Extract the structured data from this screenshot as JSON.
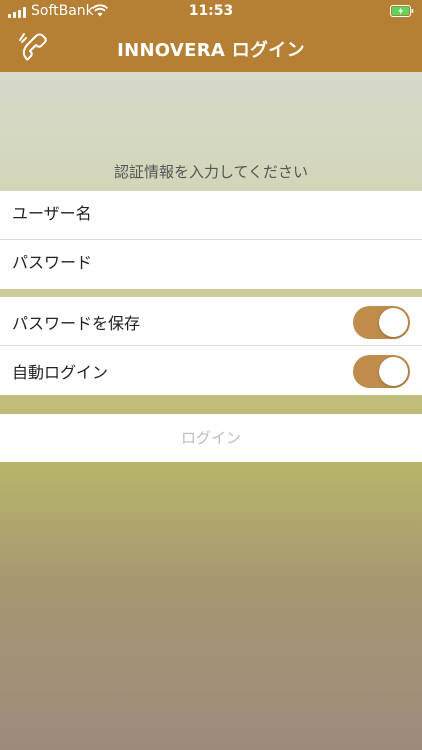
{
  "status_bar": {
    "carrier": "SoftBank",
    "time": "11:53"
  },
  "nav": {
    "title": "INNOVERA ログイン",
    "left_icon": "phone-icon"
  },
  "form": {
    "section_header": "認証情報を入力してください",
    "username_placeholder": "ユーザー名",
    "password_placeholder": "パスワード"
  },
  "options": {
    "save_password_label": "パスワードを保存",
    "save_password_on": true,
    "auto_login_label": "自動ログイン",
    "auto_login_on": true
  },
  "actions": {
    "login_label": "ログイン"
  },
  "colors": {
    "nav_bar": "#b57f34",
    "toggle_on": "#bf8c4c",
    "login_disabled_text": "#bdbdbd"
  }
}
